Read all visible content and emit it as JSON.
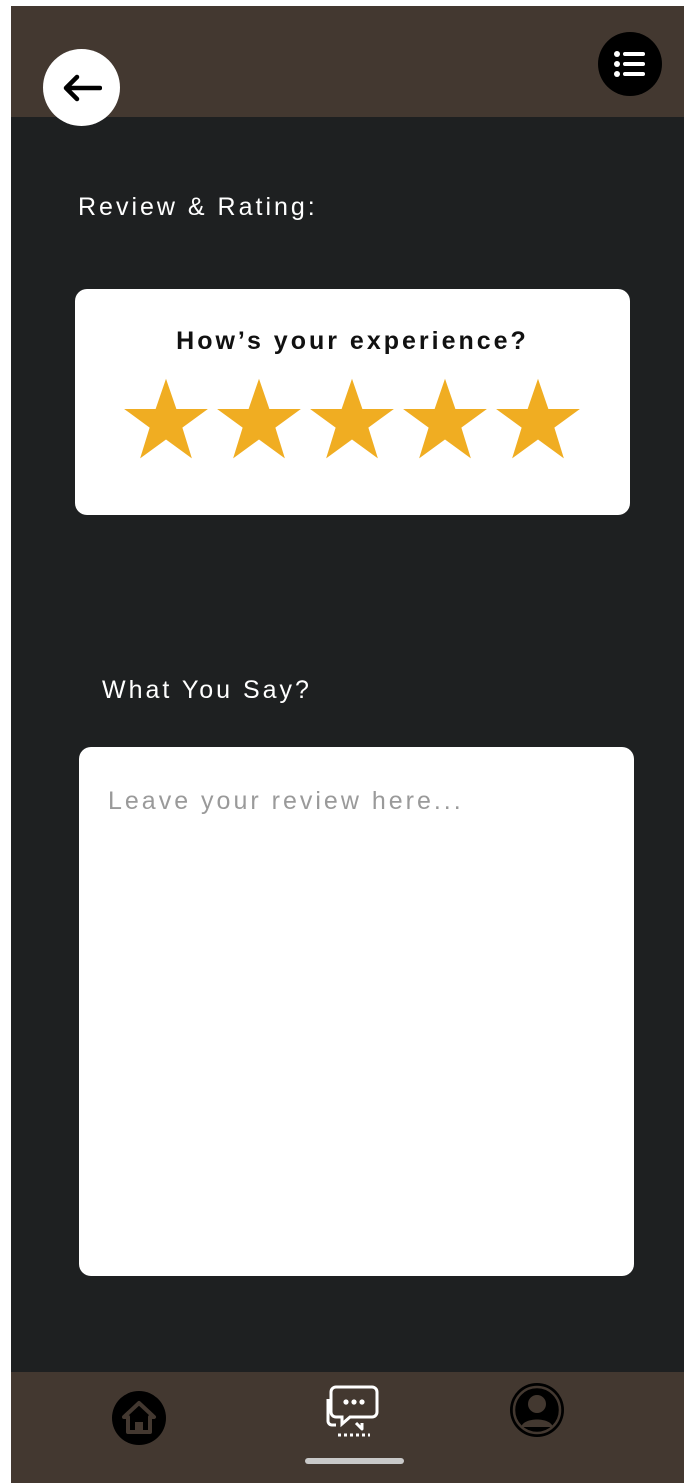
{
  "header": {
    "back_icon": "arrow-left-icon",
    "menu_icon": "list-icon"
  },
  "rating_section": {
    "title": "Review & Rating:",
    "question": "How’s your experience?",
    "rating": 5,
    "max_rating": 5,
    "star_color": "#F0AD22"
  },
  "review_section": {
    "title": "What You Say?",
    "value": "",
    "placeholder": "Leave your review here..."
  },
  "bottom_nav": {
    "items": [
      {
        "icon": "home-icon",
        "active": false
      },
      {
        "icon": "chat-bubbles-icon",
        "active": true
      },
      {
        "icon": "user-profile-icon",
        "active": false
      }
    ]
  },
  "colors": {
    "background": "#1E2021",
    "bar": "#433830",
    "card": "#FFFFFF"
  }
}
